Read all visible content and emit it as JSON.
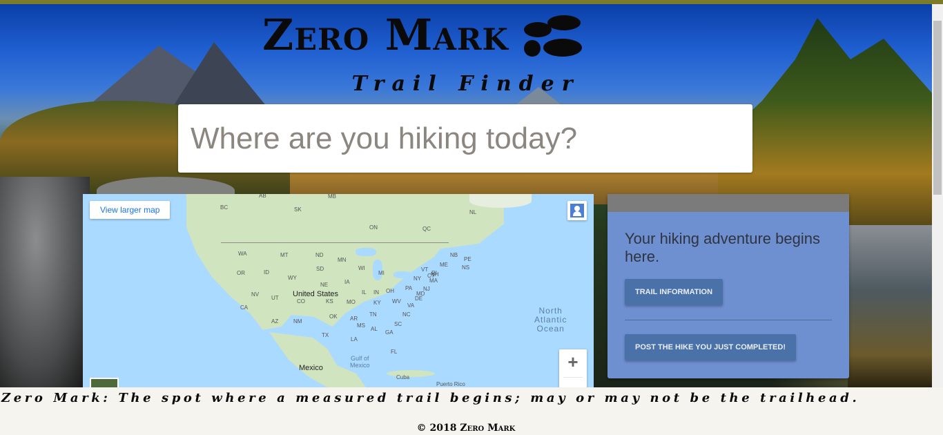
{
  "brand": {
    "title": "Zero Mark",
    "subtitle": "Trail Finder",
    "logo_icon": "footprints-icon"
  },
  "search": {
    "placeholder": "Where are you hiking today?",
    "value": ""
  },
  "map": {
    "larger_map_link": "View larger map",
    "labels": {
      "country_us": "United States",
      "country_mexico": "Mexico",
      "cuba": "Cuba",
      "puerto_rico": "Puerto Rico",
      "ocean_line1": "North",
      "ocean_line2": "Atlantic",
      "ocean_line3": "Ocean",
      "gulf_line1": "Gulf of",
      "gulf_line2": "Mexico",
      "ab": "AB",
      "mb": "MB",
      "bc": "BC",
      "sk": "SK",
      "nl": "NL",
      "on": "ON",
      "qc": "QC",
      "wa": "WA",
      "mt": "MT",
      "nd": "ND",
      "mn": "MN",
      "or": "OR",
      "id": "ID",
      "sd": "SD",
      "wi": "WI",
      "mi": "MI",
      "wy": "WY",
      "ne": "NE",
      "ia": "IA",
      "nv": "NV",
      "ut": "UT",
      "co": "CO",
      "ks": "KS",
      "mo": "MO",
      "ca": "CA",
      "il": "IL",
      "in": "IN",
      "oh": "OH",
      "pa": "PA",
      "ny": "NY",
      "az": "AZ",
      "nm": "NM",
      "ok": "OK",
      "ar": "AR",
      "tn": "TN",
      "ky": "KY",
      "wv": "WV",
      "va": "VA",
      "nc": "NC",
      "sc": "SC",
      "ms": "MS",
      "al": "AL",
      "ga": "GA",
      "la": "LA",
      "tx": "TX",
      "fl": "FL",
      "md": "MD",
      "de": "DE",
      "nj": "NJ",
      "ct": "CT",
      "ri": "RI",
      "ma": "MA",
      "nh": "NH",
      "me": "ME",
      "nb": "NB",
      "pe": "PE",
      "ns": "NS",
      "vt": "VT"
    },
    "zoom_in_label": "+",
    "pegman_icon": "pegman-icon"
  },
  "card": {
    "title": "Your hiking adventure begins here.",
    "trail_info_button": "Trail Information",
    "post_hike_button": "Post the hike you just completed!"
  },
  "footer": {
    "tagline": "Zero Mark: The spot where a measured trail begins; may or may not be the trailhead.",
    "copyright": "© 2018 Zero Mark"
  }
}
